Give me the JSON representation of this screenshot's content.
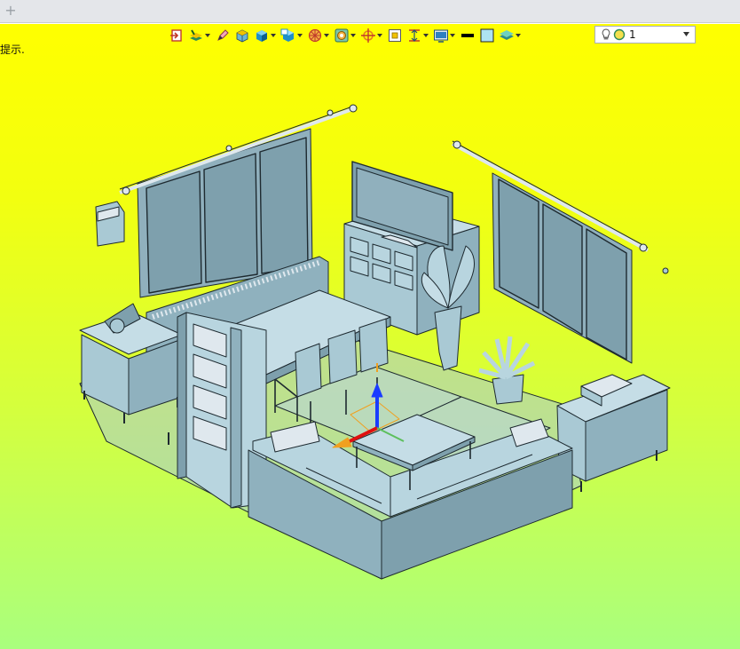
{
  "tabbar": {
    "add_label": "+"
  },
  "viewport": {
    "hint": "提示."
  },
  "toolbar": {
    "tools": [
      {
        "icon": "exit-sketch-icon"
      },
      {
        "icon": "layer-icon"
      },
      {
        "icon": "pencil-icon"
      },
      {
        "icon": "solid-box-icon"
      },
      {
        "icon": "shaded-cube-icon"
      },
      {
        "icon": "display-mode-icon"
      },
      {
        "icon": "section-icon"
      },
      {
        "icon": "filter-icon"
      },
      {
        "icon": "snap-target-icon"
      },
      {
        "icon": "frame-icon"
      },
      {
        "icon": "dimension-icon"
      },
      {
        "icon": "view-window-icon"
      },
      {
        "icon": "line-color-icon"
      },
      {
        "icon": "face-color-icon"
      },
      {
        "icon": "surface-layer-icon"
      }
    ],
    "light_value": "1"
  },
  "colors": {
    "model": "#a9c9d4",
    "model_dark": "#7fa3b0",
    "edge": "#1e2a30",
    "accent_blue": "#1a3cff",
    "accent_red": "#e01010",
    "accent_orange": "#f0a020"
  }
}
